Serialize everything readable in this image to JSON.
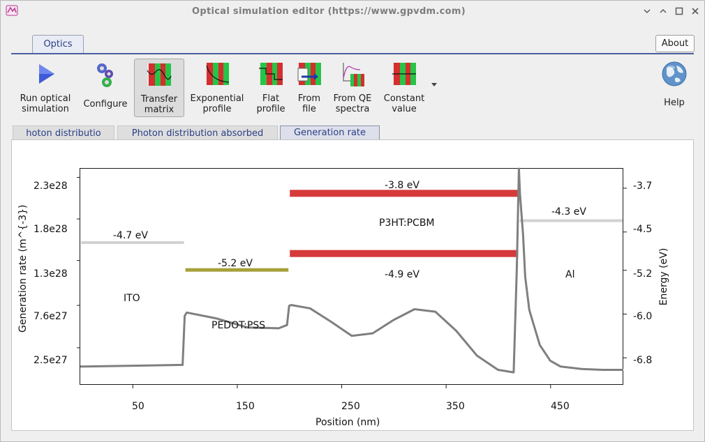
{
  "window": {
    "title": "Optical simulation editor (https://www.gpvdm.com)",
    "controls": [
      "minimize",
      "restore",
      "maximize",
      "close"
    ]
  },
  "main_tab": {
    "label": "Optics"
  },
  "about_label": "About",
  "toolbar": {
    "run": "Run optical\nsimulation",
    "configure": "Configure",
    "transfer": "Transfer\nmatrix",
    "exponential": "Exponential\nprofile",
    "flat": "Flat\nprofile",
    "fromfile": "From\nfile",
    "qe": "From QE\nspectra",
    "constant": "Constant\nvalue",
    "help": "Help",
    "active": "transfer"
  },
  "subtabs": {
    "photon_dist": "hoton distributio",
    "photon_abs": "Photon distribution absorbed",
    "generation": "Generation rate"
  },
  "chart_data": {
    "type": "line",
    "xlabel": "Position (nm)",
    "ylabel": "Generation rate (m^{-3})",
    "y2label": "Energy (eV)",
    "xticks": [
      "50",
      "150",
      "250",
      "350",
      "450"
    ],
    "yticks": [
      "2.3e28",
      "1.8e28",
      "1.3e28",
      "7.6e27",
      "2.5e27"
    ],
    "y2ticks": [
      "-3.7",
      "-4.5",
      "-5.2",
      "-6.0",
      "-6.8"
    ],
    "xlim": [
      0,
      520
    ],
    "ylim": [
      -2e+27,
      2.4e+28
    ],
    "y2lim": [
      -7.3,
      -3.35
    ],
    "layers": [
      {
        "name": "ITO",
        "x0": 0,
        "x1": 100,
        "bands": [
          {
            "label": "-4.7 eV",
            "energy": -4.7,
            "color": "#d2d2d2"
          }
        ]
      },
      {
        "name": "PEDOT:PSS",
        "x0": 100,
        "x1": 200,
        "bands": [
          {
            "label": "-5.2 eV",
            "energy": -5.2,
            "color": "#a6a03a"
          }
        ]
      },
      {
        "name": "P3HT:PCBM",
        "x0": 200,
        "x1": 420,
        "bands": [
          {
            "label": "-3.8 eV",
            "energy": -3.8,
            "color": "#d6393a"
          },
          {
            "label": "-4.9 eV",
            "energy": -4.9,
            "color": "#d6393a"
          }
        ]
      },
      {
        "name": "Al",
        "x0": 420,
        "x1": 520,
        "bands": [
          {
            "label": "-4.3 eV",
            "energy": -4.3,
            "color": "#d2d2d2"
          }
        ]
      }
    ],
    "series": [
      {
        "color": "#7f7f7f",
        "x": [
          0,
          50,
          98,
          100,
          102,
          130,
          160,
          190,
          198,
          200,
          202,
          220,
          240,
          260,
          280,
          300,
          320,
          340,
          360,
          380,
          400,
          415,
          418,
          420,
          421,
          424,
          426,
          430,
          440,
          450,
          460,
          480,
          500,
          520
        ],
        "y": [
          200000000000000000000000000,
          300000000000000000000000000,
          400000000000000000000000000,
          6300000000000000000000000000,
          6700000000000000000000000000,
          6000000000000000000000000000,
          4900000000000000000000000000,
          4800000000000000000000000000,
          5200000000000000000000000000,
          7500000000000000000000000000,
          7600000000000000000000000000,
          7200000000000000000000000000,
          5600000000000000000000000000,
          3900000000000000000000000000,
          4200000000000000000000000000,
          5800000000000000000000000000,
          7100000000000000000000000000,
          6800000000000000000000000000,
          4500000000000000000000000000,
          1500000000000000000000000000,
          -200000000000000000000000000,
          -500000000000000000000000000,
          12000000000000000000000000000,
          25000000000000000000000000000,
          21000000000000000000000000000,
          16000000000000000000000000000,
          11000000000000000000000000000,
          7000000000000000000000000000,
          2800000000000000000000000000,
          900000000000000000000000000,
          200000000000000000000000000,
          -100000000000000000000000000,
          -200000000000000000000000000,
          -200000000000000000000000000
        ]
      }
    ]
  }
}
